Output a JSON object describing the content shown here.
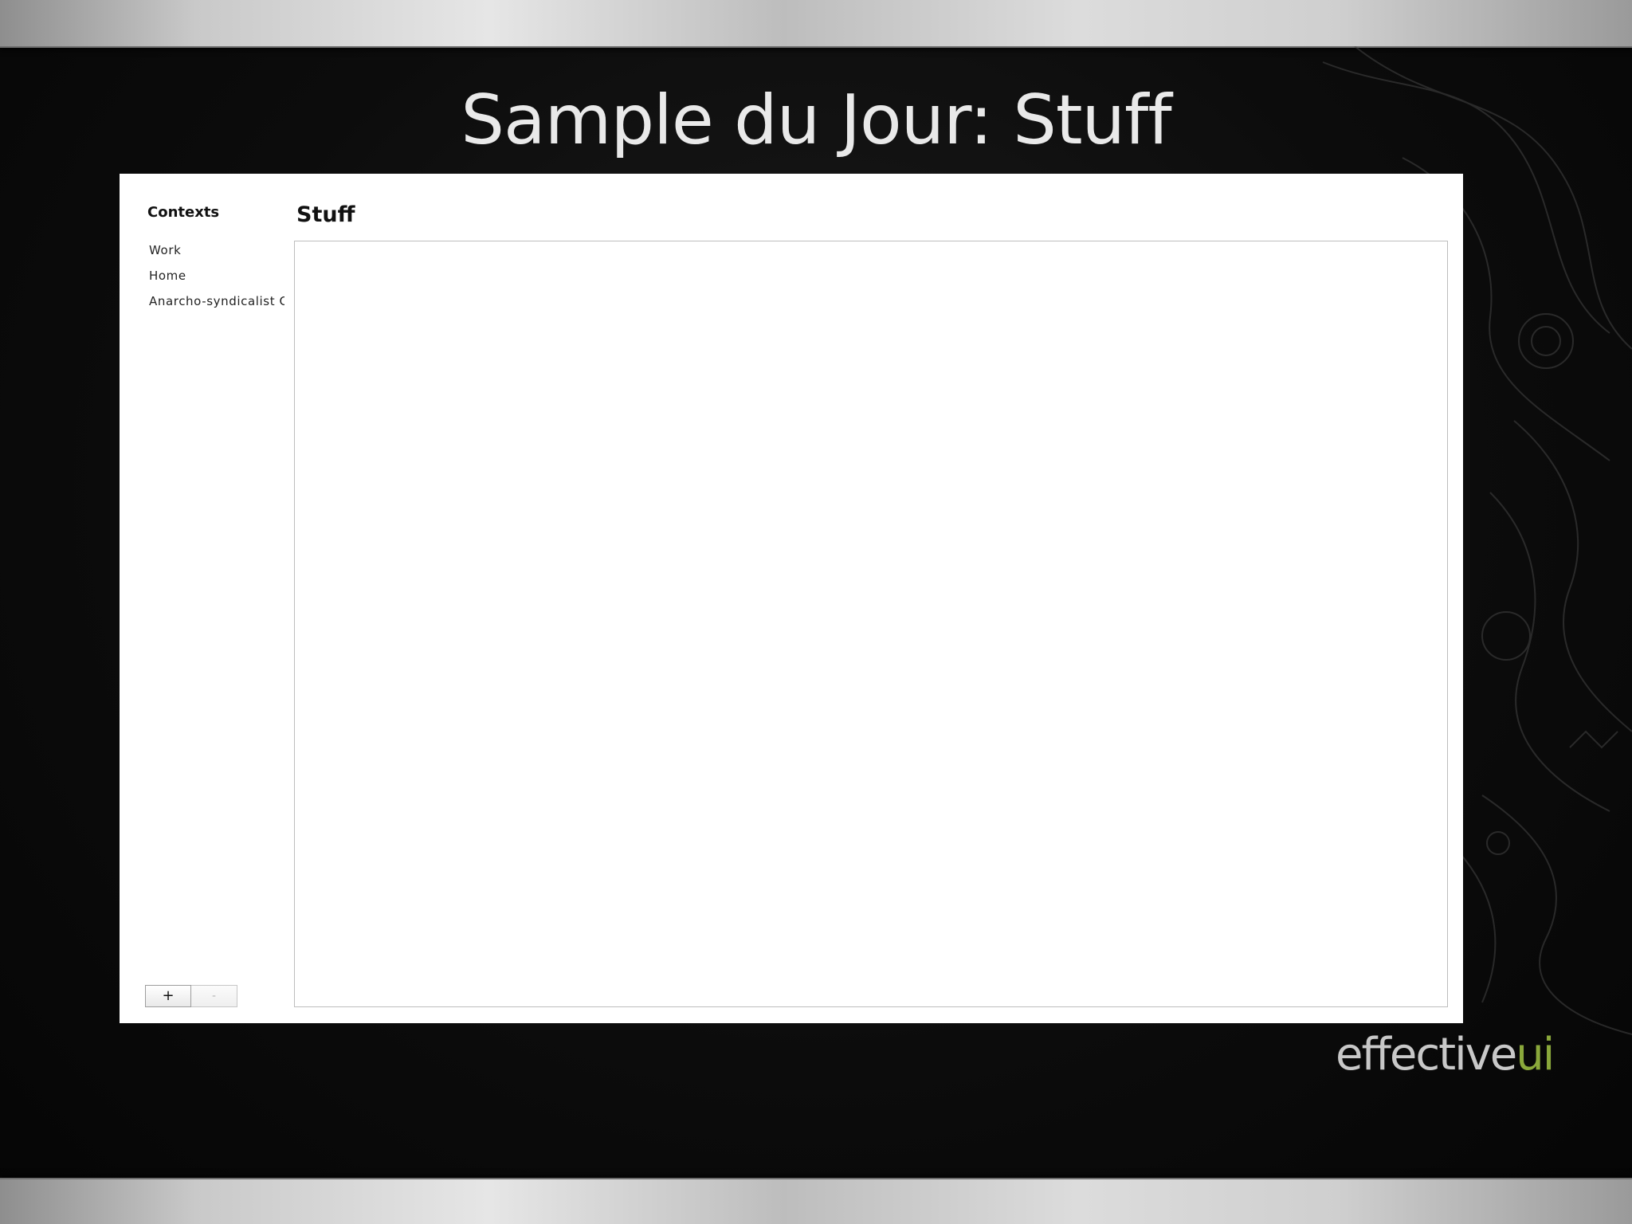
{
  "slide": {
    "title": "Sample du Jour: Stuff"
  },
  "sidebar": {
    "title": "Contexts",
    "items": [
      {
        "label": "Work"
      },
      {
        "label": "Home"
      },
      {
        "label": "Anarcho-syndicalist C"
      }
    ],
    "add_label": "+",
    "remove_label": "-"
  },
  "main": {
    "title": "Stuff"
  },
  "brand": {
    "text_main": "effective",
    "text_accent": "ui",
    "accent_color": "#8aa83b"
  }
}
